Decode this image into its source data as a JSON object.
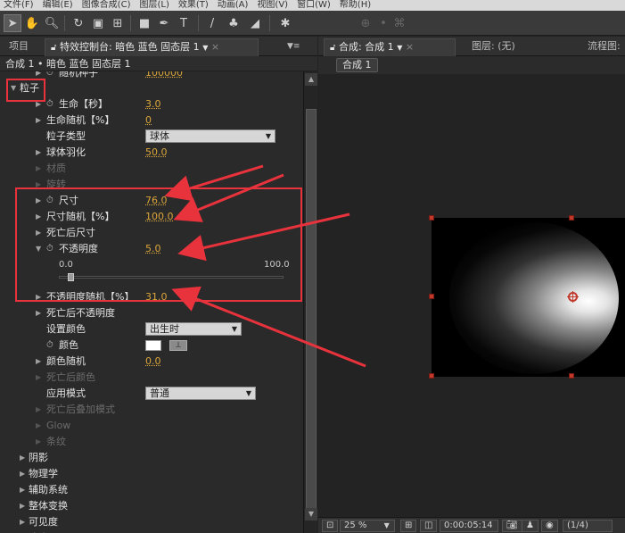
{
  "menu": [
    "文件(F)",
    "编辑(E)",
    "图像合成(C)",
    "图层(L)",
    "效果(T)",
    "动画(A)",
    "视图(V)",
    "窗口(W)",
    "帮助(H)"
  ],
  "left_tabs": {
    "project": "项目",
    "effect_controls": "特效控制台: 暗色 蓝色 固态层 1",
    "menu_icon": "▼≡"
  },
  "comp_line": "合成 1 • 暗色 蓝色 固态层 1",
  "top_partial": {
    "label": "随机种子",
    "value": "100000"
  },
  "particle_group": "粒子",
  "properties": {
    "life": {
      "label": "生命【秒】",
      "value": "3.0"
    },
    "life_random": {
      "label": "生命随机【%】",
      "value": "0"
    },
    "particle_type": {
      "label": "粒子类型",
      "value": "球体"
    },
    "sphere_feather": {
      "label": "球体羽化",
      "value": "50.0"
    },
    "texture": {
      "label": "材质"
    },
    "rotation": {
      "label": "旋转"
    },
    "size": {
      "label": "尺寸",
      "value": "76.0"
    },
    "size_random": {
      "label": "尺寸随机【%】",
      "value": "100.0"
    },
    "size_over_life": {
      "label": "死亡后尺寸"
    },
    "opacity": {
      "label": "不透明度",
      "value": "5.0",
      "min": "0.0",
      "max": "100.0",
      "level": 0.05
    },
    "opacity_random": {
      "label": "不透明度随机【%】",
      "value": "31.0"
    },
    "opacity_over_life": {
      "label": "死亡后不透明度"
    },
    "set_color": {
      "label": "设置颜色",
      "value": "出生时"
    },
    "color": {
      "label": "颜色",
      "swatch": "#ffffff"
    },
    "color_random": {
      "label": "颜色随机",
      "value": "0.0"
    },
    "color_over_life": {
      "label": "死亡后颜色"
    },
    "blend_mode": {
      "label": "应用模式",
      "value": "普通"
    },
    "transfer_mode_over_life": {
      "label": "死亡后叠加模式"
    },
    "glow": {
      "label": "Glow"
    },
    "streak": {
      "label": "条纹"
    }
  },
  "groups": [
    "阴影",
    "物理学",
    "辅助系统",
    "整体变换",
    "可见度",
    "渲染"
  ],
  "right_tabs": {
    "composition": "合成: 合成 1",
    "layer": "图层: (无)",
    "flowchart": "流程图:"
  },
  "comp_chip": "合成 1",
  "viewer_bottom": {
    "zoom": "25 %",
    "timecode": "0:00:05:14",
    "resolution": "(1/4)"
  },
  "colors": {
    "annotation": "#e8323c",
    "value": "#d9a53a",
    "handle": "#c0392b"
  }
}
